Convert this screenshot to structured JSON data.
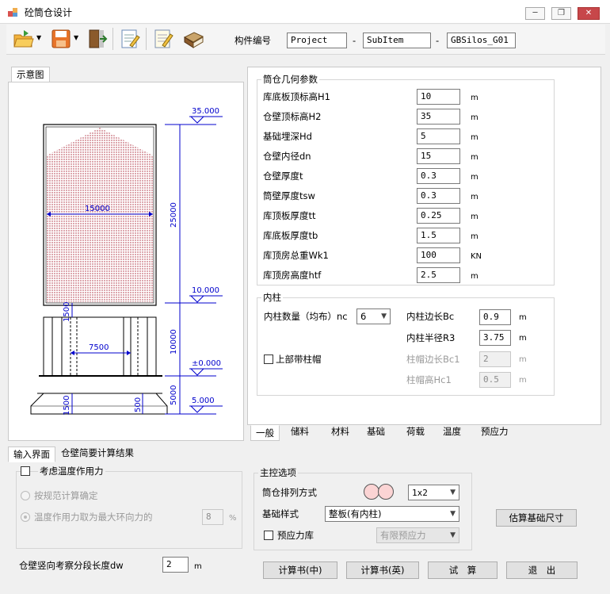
{
  "window": {
    "title": "砼筒仓设计"
  },
  "toolbar": {
    "component_label": "构件编号",
    "project": "Project",
    "subitem": "SubItem",
    "sep1": "-",
    "sep2": "-",
    "code": "GBSilos_G01"
  },
  "diagram_tab": "示意图",
  "drawing": {
    "elev_top": "35.000",
    "elev_mid": "10.000",
    "elev_ground": "±0.000",
    "elev_bottom": "5.000",
    "dim_diameter": "15000",
    "dim_height": "25000",
    "dim_col_height": "10000",
    "dim_col_spacing": "7500",
    "dim_1500_a": "1500",
    "dim_1500_b": "1500",
    "dim_500": "500",
    "dim_5000": "5000"
  },
  "geom": {
    "title": "筒仓几何参数",
    "rows": [
      {
        "label": "库底板顶标高H1",
        "value": "10",
        "unit": "m"
      },
      {
        "label": "仓壁顶标高H2",
        "value": "35",
        "unit": "m"
      },
      {
        "label": "基础埋深Hd",
        "value": "5",
        "unit": "m"
      },
      {
        "label": "仓壁内径dn",
        "value": "15",
        "unit": "m"
      },
      {
        "label": "仓壁厚度t",
        "value": "0.3",
        "unit": "m"
      },
      {
        "label": "筒壁厚度tsw",
        "value": "0.3",
        "unit": "m"
      },
      {
        "label": "库顶板厚度tt",
        "value": "0.25",
        "unit": "m"
      },
      {
        "label": "库底板厚度tb",
        "value": "1.5",
        "unit": "m"
      },
      {
        "label": "库顶房总重Wk1",
        "value": "100",
        "unit": "KN"
      },
      {
        "label": "库顶房高度htf",
        "value": "2.5",
        "unit": "m"
      }
    ]
  },
  "column": {
    "title": "内柱",
    "count_label": "内柱数量（均布）nc",
    "count_value": "6",
    "side_label": "内柱边长Bc",
    "side_value": "0.9",
    "side_unit": "m",
    "radius_label": "内柱半径R3",
    "radius_value": "3.75",
    "radius_unit": "m",
    "cap_label": "上部带柱帽",
    "cap_side_label": "柱帽边长Bc1",
    "cap_side_value": "2",
    "cap_side_unit": "m",
    "cap_height_label": "柱帽高Hc1",
    "cap_height_value": "0.5",
    "cap_height_unit": "m"
  },
  "right_tabs": [
    "一般",
    "储料",
    "材料",
    "基础",
    "荷载",
    "温度",
    "预应力"
  ],
  "bottom_tabs": [
    "输入界面",
    "仓壁简要计算结果"
  ],
  "temperature": {
    "consider_label": "考虑温度作用力",
    "by_spec_label": "按规范计算确定",
    "max_ring_label": "温度作用力取为最大环向力的",
    "percent_value": "8",
    "percent_unit": "%"
  },
  "seg_label": "仓壁竖向考察分段长度dw",
  "seg_value": "2",
  "seg_unit": "m",
  "main_options": {
    "title": "主控选项",
    "arrange_label": "筒仓排列方式",
    "arrange_value": "1x2",
    "foundation_label": "基础样式",
    "foundation_value": "整板(有内柱)",
    "prestress_label": "预应力库",
    "prestress_value": "有限预应力"
  },
  "buttons": {
    "estimate": "估算基础尺寸",
    "calc_cn": "计算书(中)",
    "calc_en": "计算书(英)",
    "trial": "试　算",
    "exit": "退　出"
  }
}
